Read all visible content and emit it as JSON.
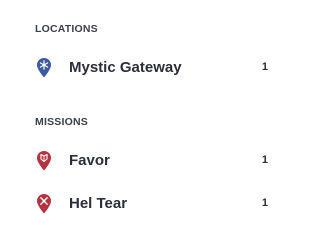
{
  "locations": {
    "header": "LOCATIONS",
    "items": [
      {
        "label": "Mystic Gateway",
        "count": "1",
        "icon": "snowflake-pin-icon",
        "color": "#3d5a9e"
      }
    ]
  },
  "missions": {
    "header": "MISSIONS",
    "items": [
      {
        "label": "Favor",
        "count": "1",
        "icon": "mission-pin-icon",
        "color": "#b5323f"
      },
      {
        "label": "Hel Tear",
        "count": "1",
        "icon": "mission-pin-icon",
        "color": "#b5323f"
      }
    ]
  }
}
